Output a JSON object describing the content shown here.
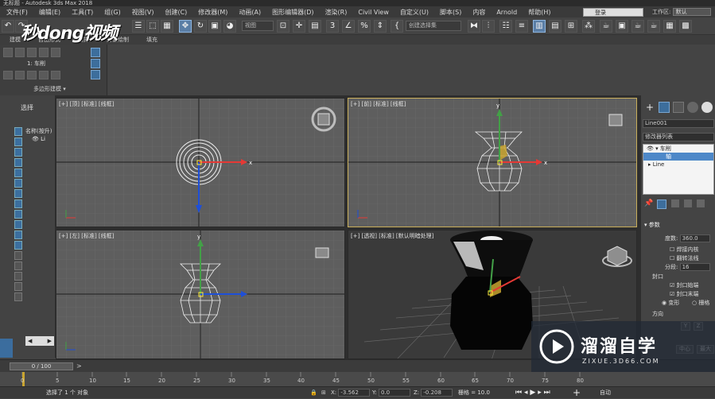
{
  "window": {
    "title": "无标题 - Autodesk 3ds Max 2018"
  },
  "menu": [
    "文件(F)",
    "编辑(E)",
    "工具(T)",
    "组(G)",
    "视图(V)",
    "创建(C)",
    "修改器(M)",
    "动画(A)",
    "图形编辑器(D)",
    "渲染(R)",
    "Civil View",
    "自定义(U)",
    "脚本(S)",
    "内容",
    "Arnold",
    "帮助(H)"
  ],
  "account": {
    "login_label": "登录",
    "workspace_label": "工作区:",
    "workspace_value": "默认"
  },
  "toolbar": {
    "view_dropdown": "视图",
    "selection_set_placeholder": "创建选择集",
    "count_3": "3",
    "percent": "%"
  },
  "ribbon": {
    "tabs": [
      "建模",
      "自由形式",
      "选择",
      "对象绘制",
      "填充"
    ],
    "panel_label": "多边形建模",
    "stack_item": "1: 车削"
  },
  "watermark_logo": "秒dong视频",
  "scene_explorer": {
    "title": "选择",
    "column": "名称(按升)",
    "item": "Li"
  },
  "viewports": {
    "top": "[+] [顶] [标准] [线框]",
    "front": "[+] [前] [标准] [线框]",
    "left": "[+] [左] [标准] [线框]",
    "persp": "[+] [透视] [标准] [默认明暗处理]"
  },
  "axis_labels": {
    "x": "x",
    "y": "y",
    "z": "z"
  },
  "command_panel": {
    "object_name": "Line001",
    "modifier_list": "修改器列表",
    "stack": [
      "车削",
      "轴",
      "Line"
    ],
    "rollout_title": "参数",
    "degrees_label": "度数:",
    "degrees_value": "360.0",
    "weld_core": "焊接内核",
    "flip_normals": "翻转法线",
    "segments_label": "分段:",
    "segments_value": "16",
    "capping_title": "封口",
    "cap_start": "封口始端",
    "cap_end": "封口末端",
    "morph": "变形",
    "grid": "栅格",
    "direction_title": "方向",
    "dir_y": "Y",
    "dir_z": "Z",
    "center": "中心",
    "max": "最大"
  },
  "timeline": {
    "frame_display": "0 / 100",
    "ticks": [
      "0",
      "5",
      "10",
      "15",
      "20",
      "25",
      "30",
      "35",
      "40",
      "45",
      "50",
      "55",
      "60",
      "65",
      "70",
      "75",
      "80"
    ]
  },
  "status": {
    "selected_text": "选择了 1 个 对象",
    "x_label": "X:",
    "x_value": "-3.562",
    "y_label": "Y:",
    "y_value": "0.0",
    "z_label": "Z:",
    "z_value": "-0.208",
    "grid_label": "栅格 = 10.0",
    "auto_label": "自动"
  },
  "brand_watermark": {
    "name": "溜溜自学",
    "url": "ZIXUE.3D66.COM"
  }
}
